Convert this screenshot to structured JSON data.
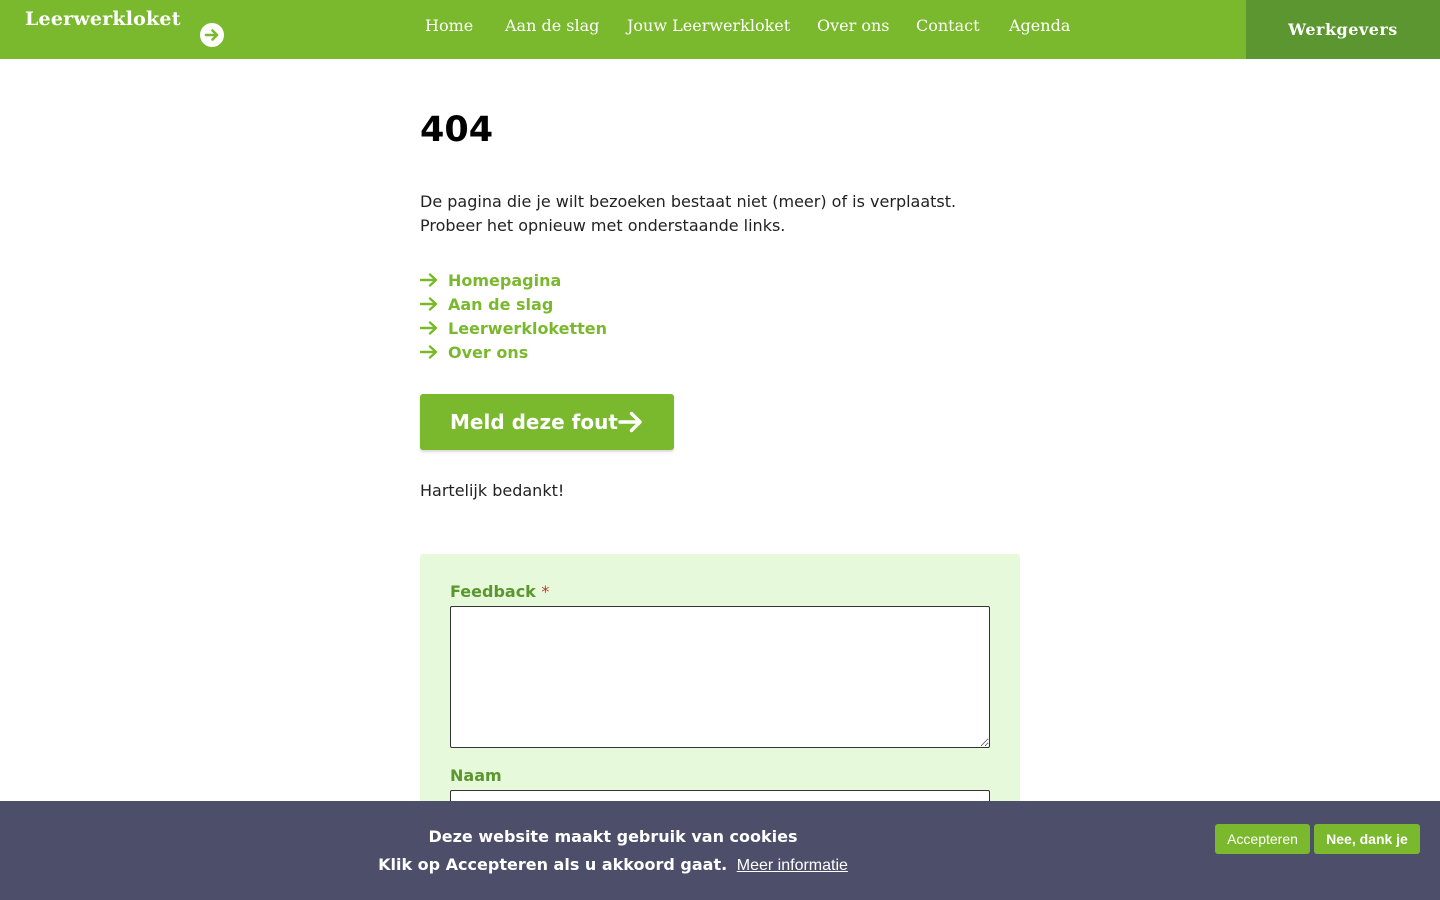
{
  "header": {
    "logo_text": "Leerwerkloket",
    "nav": [
      "Home",
      "Aan de slag",
      "Jouw Leerwerkloket",
      "Over ons",
      "Contact",
      "Agenda"
    ],
    "werkgevers_label": "Werkgevers"
  },
  "main": {
    "title": "404",
    "intro": "De pagina die je wilt bezoeken bestaat niet (meer) of is verplaatst. Probeer het opnieuw met onderstaande links.",
    "links": [
      "Homepagina",
      "Aan de slag",
      "Leerwerkloketten",
      "Over ons"
    ],
    "report_button": "Meld deze fout",
    "thanks": "Hartelijk bedankt!"
  },
  "form": {
    "feedback_label": "Feedback",
    "required_marker": "*",
    "name_label": "Naam",
    "feedback_value": "",
    "name_value": ""
  },
  "cookie": {
    "line1": "Deze website maakt gebruik van cookies",
    "line2": "Klik op Accepteren als u akkoord gaat.",
    "more_info": "Meer informatie",
    "accept": "Accepteren",
    "decline": "Nee, dank je"
  },
  "colors": {
    "brand_green": "#7ab92e",
    "dark_green": "#5b9630",
    "form_bg": "#e6f9da",
    "cookie_bg": "#4c4e6a"
  },
  "icons": {
    "logo_arrow": "arrow-circle-right-icon",
    "link_arrow": "arrow-right-icon",
    "button_arrow": "arrow-right-icon"
  }
}
